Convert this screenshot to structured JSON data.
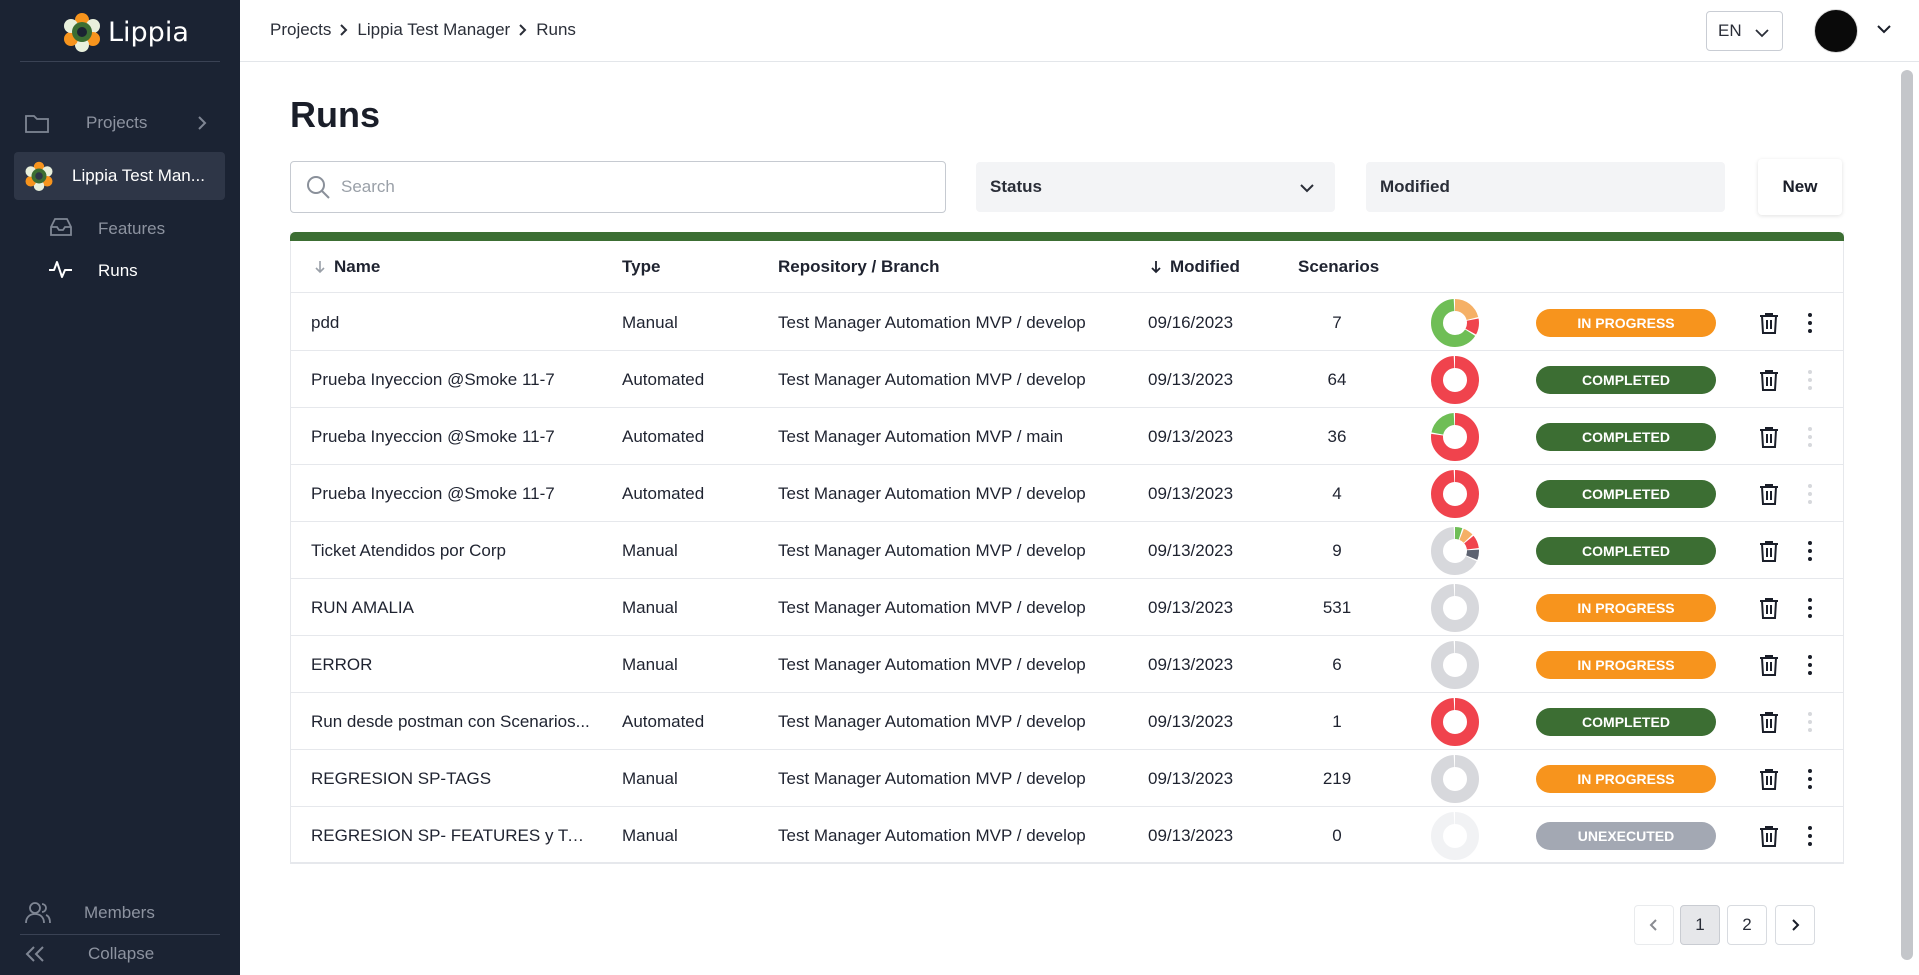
{
  "app": {
    "name": "Lippia",
    "brand_green": "#3c6e33"
  },
  "sidebar": {
    "projects_label": "Projects",
    "project_label": "Lippia Test Man...",
    "features_label": "Features",
    "runs_label": "Runs",
    "members_label": "Members",
    "collapse_label": "Collapse"
  },
  "breadcrumb": [
    "Projects",
    "Lippia Test Manager",
    "Runs"
  ],
  "header": {
    "language": "EN"
  },
  "page": {
    "title": "Runs",
    "search_placeholder": "Search",
    "status_filter": "Status",
    "modified_filter": "Modified",
    "new_button": "New"
  },
  "table": {
    "columns": {
      "name": "Name",
      "type": "Type",
      "repo": "Repository / Branch",
      "modified": "Modified",
      "scenarios": "Scenarios"
    },
    "rows": [
      {
        "name": "pdd",
        "type": "Manual",
        "repo": "Test Manager Automation MVP / develop",
        "modified": "09/16/2023",
        "scenarios": "7",
        "status": "IN PROGRESS",
        "donut": "mixed1",
        "menu_enabled": true
      },
      {
        "name": "Prueba Inyeccion @Smoke 11-7",
        "type": "Automated",
        "repo": "Test Manager Automation MVP / develop",
        "modified": "09/13/2023",
        "scenarios": "64",
        "status": "COMPLETED",
        "donut": "red",
        "menu_enabled": false
      },
      {
        "name": "Prueba Inyeccion @Smoke 11-7",
        "type": "Automated",
        "repo": "Test Manager Automation MVP / main",
        "modified": "09/13/2023",
        "scenarios": "36",
        "status": "COMPLETED",
        "donut": "redgreen",
        "menu_enabled": false
      },
      {
        "name": "Prueba Inyeccion @Smoke 11-7",
        "type": "Automated",
        "repo": "Test Manager Automation MVP / develop",
        "modified": "09/13/2023",
        "scenarios": "4",
        "status": "COMPLETED",
        "donut": "red",
        "menu_enabled": false
      },
      {
        "name": "Ticket Atendidos por Corp",
        "type": "Manual",
        "repo": "Test Manager Automation MVP / develop",
        "modified": "09/13/2023",
        "scenarios": "9",
        "status": "COMPLETED",
        "donut": "mixed2",
        "menu_enabled": true
      },
      {
        "name": "RUN AMALIA",
        "type": "Manual",
        "repo": "Test Manager Automation MVP / develop",
        "modified": "09/13/2023",
        "scenarios": "531",
        "status": "IN PROGRESS",
        "donut": "gray",
        "menu_enabled": true
      },
      {
        "name": "ERROR",
        "type": "Manual",
        "repo": "Test Manager Automation MVP / develop",
        "modified": "09/13/2023",
        "scenarios": "6",
        "status": "IN PROGRESS",
        "donut": "gray",
        "menu_enabled": true
      },
      {
        "name": "Run desde postman con Scenarios...",
        "type": "Automated",
        "repo": "Test Manager Automation MVP / develop",
        "modified": "09/13/2023",
        "scenarios": "1",
        "status": "COMPLETED",
        "donut": "red",
        "menu_enabled": false
      },
      {
        "name": "REGRESION SP-TAGS",
        "type": "Manual",
        "repo": "Test Manager Automation MVP / develop",
        "modified": "09/13/2023",
        "scenarios": "219",
        "status": "IN PROGRESS",
        "donut": "gray",
        "menu_enabled": true
      },
      {
        "name": "REGRESION SP- FEATURES y TA...",
        "type": "Manual",
        "repo": "Test Manager Automation MVP / develop",
        "modified": "09/13/2023",
        "scenarios": "0",
        "status": "UNEXECUTED",
        "donut": "light",
        "menu_enabled": true
      }
    ]
  },
  "status_colors": {
    "IN PROGRESS": "#f7941d",
    "COMPLETED": "#3c6e33",
    "UNEXECUTED": "#a3a8b3"
  },
  "pagination": {
    "pages": [
      "1",
      "2"
    ],
    "current": "1"
  }
}
